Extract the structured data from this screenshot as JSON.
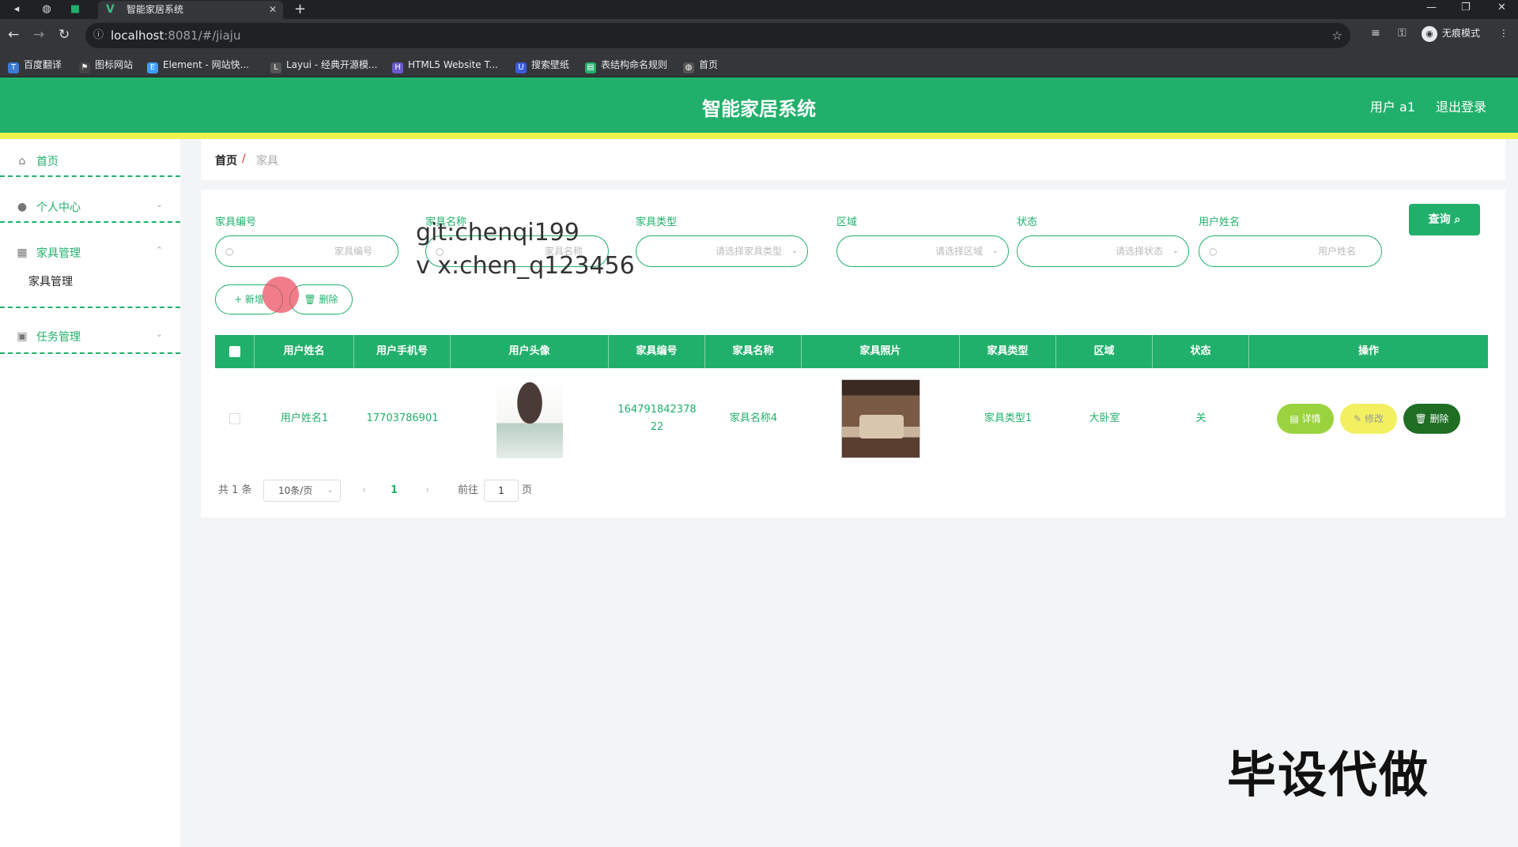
{
  "browser": {
    "tab_title": "智能家居系统",
    "url_host": "localhost",
    "url_rest": ":8081/#/jiaju",
    "incognito_label": "无痕模式",
    "bookmarks": [
      "百度翻译",
      "图标网站",
      "Element - 网站快...",
      "Layui - 经典开源模...",
      "HTML5 Website T...",
      "搜索壁纸",
      "表结构命名规则",
      "首页"
    ]
  },
  "header": {
    "title": "智能家居系统",
    "user": "用户 a1",
    "logout": "退出登录"
  },
  "sidebar": {
    "items": [
      {
        "label": "首页",
        "icon": "home-icon"
      },
      {
        "label": "个人中心",
        "icon": "user-icon"
      },
      {
        "label": "家具管理",
        "icon": "grid-icon"
      },
      {
        "label": "任务管理",
        "icon": "task-icon"
      }
    ],
    "sub_item": "家具管理"
  },
  "breadcrumb": {
    "home": "首页",
    "sep": "/",
    "current": "家具"
  },
  "filters": {
    "fields": [
      {
        "label": "家具编号",
        "placeholder": "家具编号"
      },
      {
        "label": "家具名称",
        "placeholder": "家具名称"
      },
      {
        "label": "家具类型",
        "placeholder": "请选择家具类型"
      },
      {
        "label": "区域",
        "placeholder": "请选择区域"
      },
      {
        "label": "状态",
        "placeholder": "请选择状态"
      },
      {
        "label": "用户姓名",
        "placeholder": "用户姓名"
      }
    ],
    "query_button": "查询"
  },
  "actions": {
    "add": "+ 新增",
    "delete": "删除"
  },
  "overlay": {
    "git": "git:chenqi199",
    "vx": "v x:chen_q123456",
    "watermark": "毕设代做"
  },
  "table": {
    "headers": [
      "用户姓名",
      "用户手机号",
      "用户头像",
      "家具编号",
      "家具名称",
      "家具照片",
      "家具类型",
      "区域",
      "状态",
      "操作"
    ],
    "rows": [
      {
        "username": "用户姓名1",
        "phone": "17703786901",
        "furniture_no_line1": "164791842378",
        "furniture_no_line2": "22",
        "furniture_name": "家具名称4",
        "furniture_type": "家具类型1",
        "area": "大卧室",
        "status": "关",
        "btn_detail": "详情",
        "btn_edit": "修改",
        "btn_delete": "删除"
      }
    ]
  },
  "pagination": {
    "total": "共 1 条",
    "page_size": "10条/页",
    "current": "1",
    "goto_prefix": "前往",
    "goto_value": "1",
    "goto_suffix": "页"
  },
  "colors": {
    "primary": "#21b06b",
    "accent_bar": "#eef250",
    "detail": "#9bd33f",
    "edit": "#f2f060",
    "delete": "#1f6e24"
  }
}
